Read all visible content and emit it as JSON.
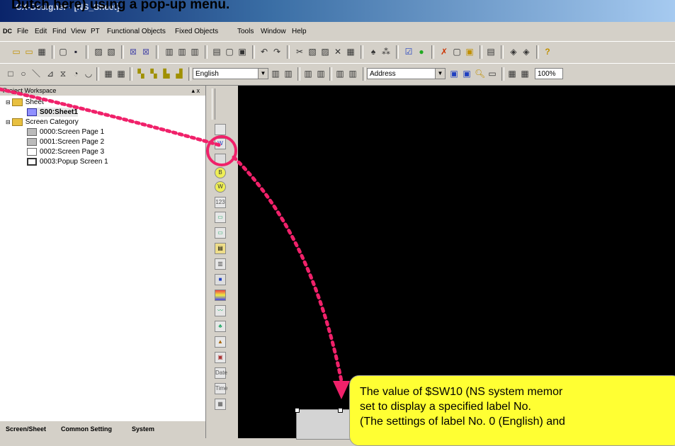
{
  "window": {
    "title": "CX-Designer - [NS_Sheet]"
  },
  "caption": "Dutch here) using a pop-up menu.",
  "menu": [
    "File",
    "Edit",
    "Find",
    "View",
    "PT",
    "Functional Objects",
    "Fixed Objects",
    "Tools",
    "Window",
    "Help"
  ],
  "toolbar": {
    "language_select": "English",
    "address_select": "Address",
    "zoom_select": "100%"
  },
  "workspace": {
    "title": "Project Workspace",
    "controls": "▴ x",
    "tree": {
      "sheet_folder": "Sheet",
      "sheet_item": "S00:Sheet1",
      "category_folder": "Screen Category",
      "pages": [
        "0000:Screen Page 1",
        "0001:Screen Page 2",
        "0002:Screen Page 3",
        "0003:Popup Screen 1"
      ]
    },
    "tabs": [
      "Screen/Sheet",
      "Common Setting",
      "System"
    ]
  },
  "callout": {
    "line1": "The value of $SW10 (NS system memor",
    "line2": "set to display a specified label No.",
    "line3": "(The settings of label No. 0 (English) and"
  },
  "colors": {
    "accent": "#f0216a",
    "callout": "#ffff33",
    "canvas": "#000000"
  }
}
